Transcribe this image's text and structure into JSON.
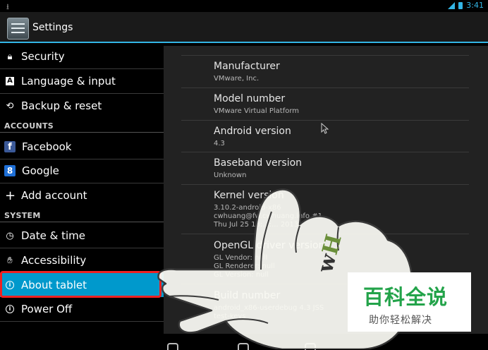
{
  "status_bar": {
    "time": "3:41",
    "download_icon": "download-icon",
    "signal_icon": "signal-icon",
    "battery_icon": "battery-icon"
  },
  "action_bar": {
    "title": "Settings",
    "icon": "settings-icon"
  },
  "sidebar": {
    "items": [
      {
        "label": "Security",
        "icon": "lock-icon"
      },
      {
        "label": "Language & input",
        "icon": "keyboard-icon"
      },
      {
        "label": "Backup & reset",
        "icon": "backup-icon"
      },
      {
        "label": "Facebook",
        "icon": "facebook-icon"
      },
      {
        "label": "Google",
        "icon": "google-icon"
      },
      {
        "label": "Add account",
        "icon": "plus-icon"
      },
      {
        "label": "Date & time",
        "icon": "clock-icon"
      },
      {
        "label": "Accessibility",
        "icon": "hand-icon"
      },
      {
        "label": "About tablet",
        "icon": "info-icon",
        "selected": true
      },
      {
        "label": "Power Off",
        "icon": "info-icon"
      }
    ],
    "headers": {
      "accounts": "ACCOUNTS",
      "system": "SYSTEM"
    }
  },
  "about": {
    "rows": [
      {
        "title": "Manufacturer",
        "summary": [
          "VMware, Inc."
        ]
      },
      {
        "title": "Model number",
        "summary": [
          "VMware Virtual Platform"
        ]
      },
      {
        "title": "Android version",
        "summary": [
          "4.3"
        ]
      },
      {
        "title": "Baseband version",
        "summary": [
          "Unknown"
        ]
      },
      {
        "title": "Kernel version",
        "summary": [
          "3.10.2-android-x86",
          "cwhuang@fw.cwhuang.info #1",
          "Thu Jul 25 18:...:... 2013"
        ]
      },
      {
        "title": "OpenGL driver version",
        "summary": [
          "GL Vendor: null",
          "GL Renderer: null",
          "GL Version: null"
        ]
      },
      {
        "title": "Build number",
        "summary": [
          "android_x86-userdebug 4.3 JSS",
          "test-keys"
        ]
      }
    ]
  },
  "watermark": {
    "main": "百科全说",
    "sub": "助你轻松解决"
  },
  "colors": {
    "accent": "#33b5e5",
    "selected": "#0099cc",
    "highlight_border": "#ee2222",
    "watermark_green": "#23a34a"
  }
}
